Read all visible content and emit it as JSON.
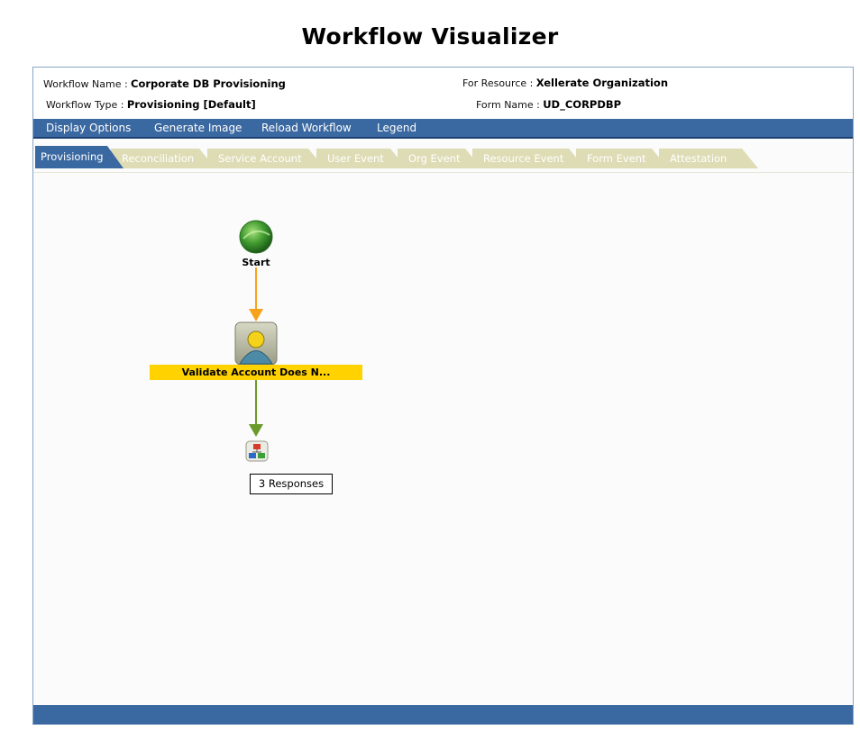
{
  "page": {
    "title": "Workflow Visualizer"
  },
  "info": {
    "workflow_name_label": "Workflow Name :",
    "workflow_name_value": "Corporate DB Provisioning",
    "workflow_type_label": "Workflow Type :",
    "workflow_type_value": "Provisioning [Default]",
    "for_resource_label": "For Resource :",
    "for_resource_value": "Xellerate Organization",
    "form_name_label": "Form Name :",
    "form_name_value": "UD_CORPDBP"
  },
  "menu": {
    "items": [
      "Display Options",
      "Generate Image",
      "Reload Workflow",
      "Legend"
    ]
  },
  "tabs": {
    "active": "Provisioning",
    "items": [
      "Provisioning",
      "Reconciliation",
      "Service Account",
      "User Event",
      "Org Event",
      "Resource Event",
      "Form Event",
      "Attestation"
    ]
  },
  "diagram": {
    "start_label": "Start",
    "task_label": "Validate Account Does N...",
    "responses_label": "3 Responses",
    "colors": {
      "start_arrow": "#f7a21b",
      "task_arrow": "#6a9a2a",
      "task_bar": "#ffd200",
      "start_node": "#3f9a2f"
    },
    "icons": {
      "start": "start-ball-icon",
      "task": "user-task-icon",
      "responses": "response-tree-icon"
    }
  }
}
